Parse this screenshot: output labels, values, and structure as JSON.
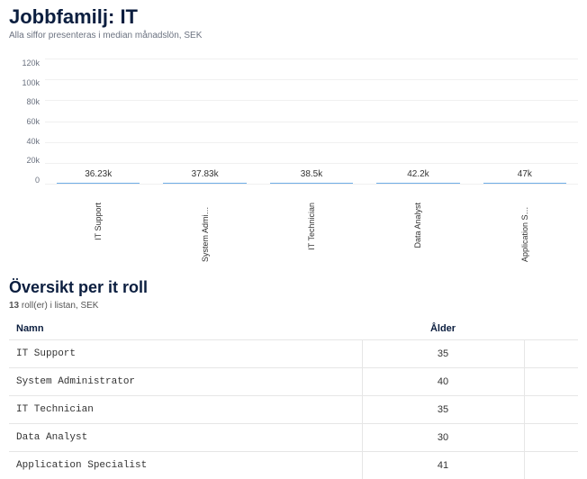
{
  "header": {
    "title": "Jobbfamilj: IT",
    "subtitle": "Alla siffor presenteras i median månadslön, SEK"
  },
  "chart_data": {
    "type": "bar",
    "title": "",
    "xlabel": "",
    "ylabel": "",
    "ylim": [
      0,
      120
    ],
    "yticks": [
      "120k",
      "100k",
      "80k",
      "60k",
      "40k",
      "20k",
      "0"
    ],
    "categories": [
      "IT Support",
      "System Administrat...",
      "IT Technician",
      "Data Analyst",
      "Application Specialist"
    ],
    "values": [
      36.23,
      37.83,
      38.5,
      42.2,
      47
    ],
    "value_labels": [
      "36.23k",
      "37.83k",
      "38.5k",
      "42.2k",
      "47k"
    ]
  },
  "overview": {
    "title": "Översikt per it roll",
    "subtitle_count": "13",
    "subtitle_rest": " roll(er) i listan, SEK",
    "col_name": "Namn",
    "col_age": "Ålder",
    "rows": [
      {
        "name": "IT Support",
        "age": "35"
      },
      {
        "name": "System Administrator",
        "age": "40"
      },
      {
        "name": "IT Technician",
        "age": "35"
      },
      {
        "name": "Data Analyst",
        "age": "30"
      },
      {
        "name": "Application Specialist",
        "age": "41"
      }
    ]
  }
}
